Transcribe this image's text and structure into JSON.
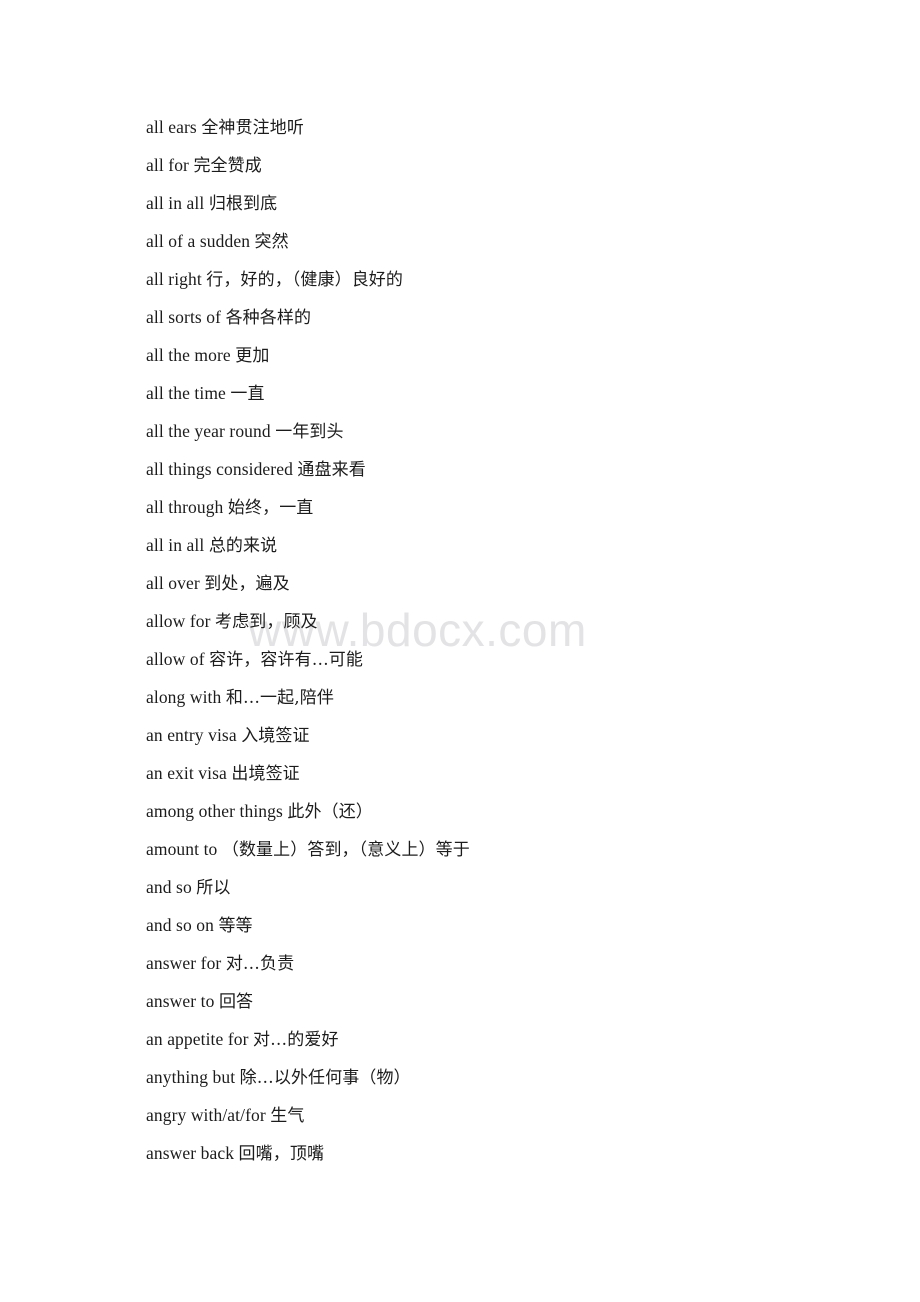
{
  "document": {
    "background_color": "#ffffff",
    "text_color": "#1c1c1c"
  },
  "watermark": {
    "text": "www.bdocx.com",
    "color": "#e3e3e5"
  },
  "entries": [
    {
      "term": "all ears ",
      "gloss": "全神贯注地听"
    },
    {
      "term": "all for ",
      "gloss": "完全赞成"
    },
    {
      "term": "all in all ",
      "gloss": "归根到底"
    },
    {
      "term": "all of a sudden ",
      "gloss": "突然"
    },
    {
      "term": "all right ",
      "gloss": "行，好的，（健康）良好的"
    },
    {
      "term": "all sorts of ",
      "gloss": "各种各样的"
    },
    {
      "term": "all the more ",
      "gloss": "更加"
    },
    {
      "term": "all the time ",
      "gloss": "一直"
    },
    {
      "term": "all the year round ",
      "gloss": "一年到头"
    },
    {
      "term": "all things considered ",
      "gloss": "通盘来看"
    },
    {
      "term": "all through ",
      "gloss": "始终，一直"
    },
    {
      "term": "all in all ",
      "gloss": "总的来说"
    },
    {
      "term": "all over ",
      "gloss": "到处，遍及"
    },
    {
      "term": "allow for ",
      "gloss": "考虑到，顾及"
    },
    {
      "term": "allow of ",
      "gloss": "容许，容许有…可能"
    },
    {
      "term": "along with ",
      "gloss": "和…一起,陪伴"
    },
    {
      "term": "an entry visa ",
      "gloss": "入境签证"
    },
    {
      "term": "an exit visa ",
      "gloss": "出境签证"
    },
    {
      "term": "among other things ",
      "gloss": "此外（还）"
    },
    {
      "term": "amount to ",
      "gloss": "（数量上）答到，（意义上）等于"
    },
    {
      "term": "and so ",
      "gloss": "所以"
    },
    {
      "term": "and so on ",
      "gloss": "等等"
    },
    {
      "term": "answer for ",
      "gloss": "对…负责"
    },
    {
      "term": "answer to ",
      "gloss": "回答"
    },
    {
      "term": "an appetite for ",
      "gloss": "对…的爱好"
    },
    {
      "term": "anything but ",
      "gloss": "除…以外任何事（物）"
    },
    {
      "term": "angry with/at/for ",
      "gloss": "生气"
    },
    {
      "term": "answer back ",
      "gloss": "回嘴，顶嘴"
    }
  ]
}
